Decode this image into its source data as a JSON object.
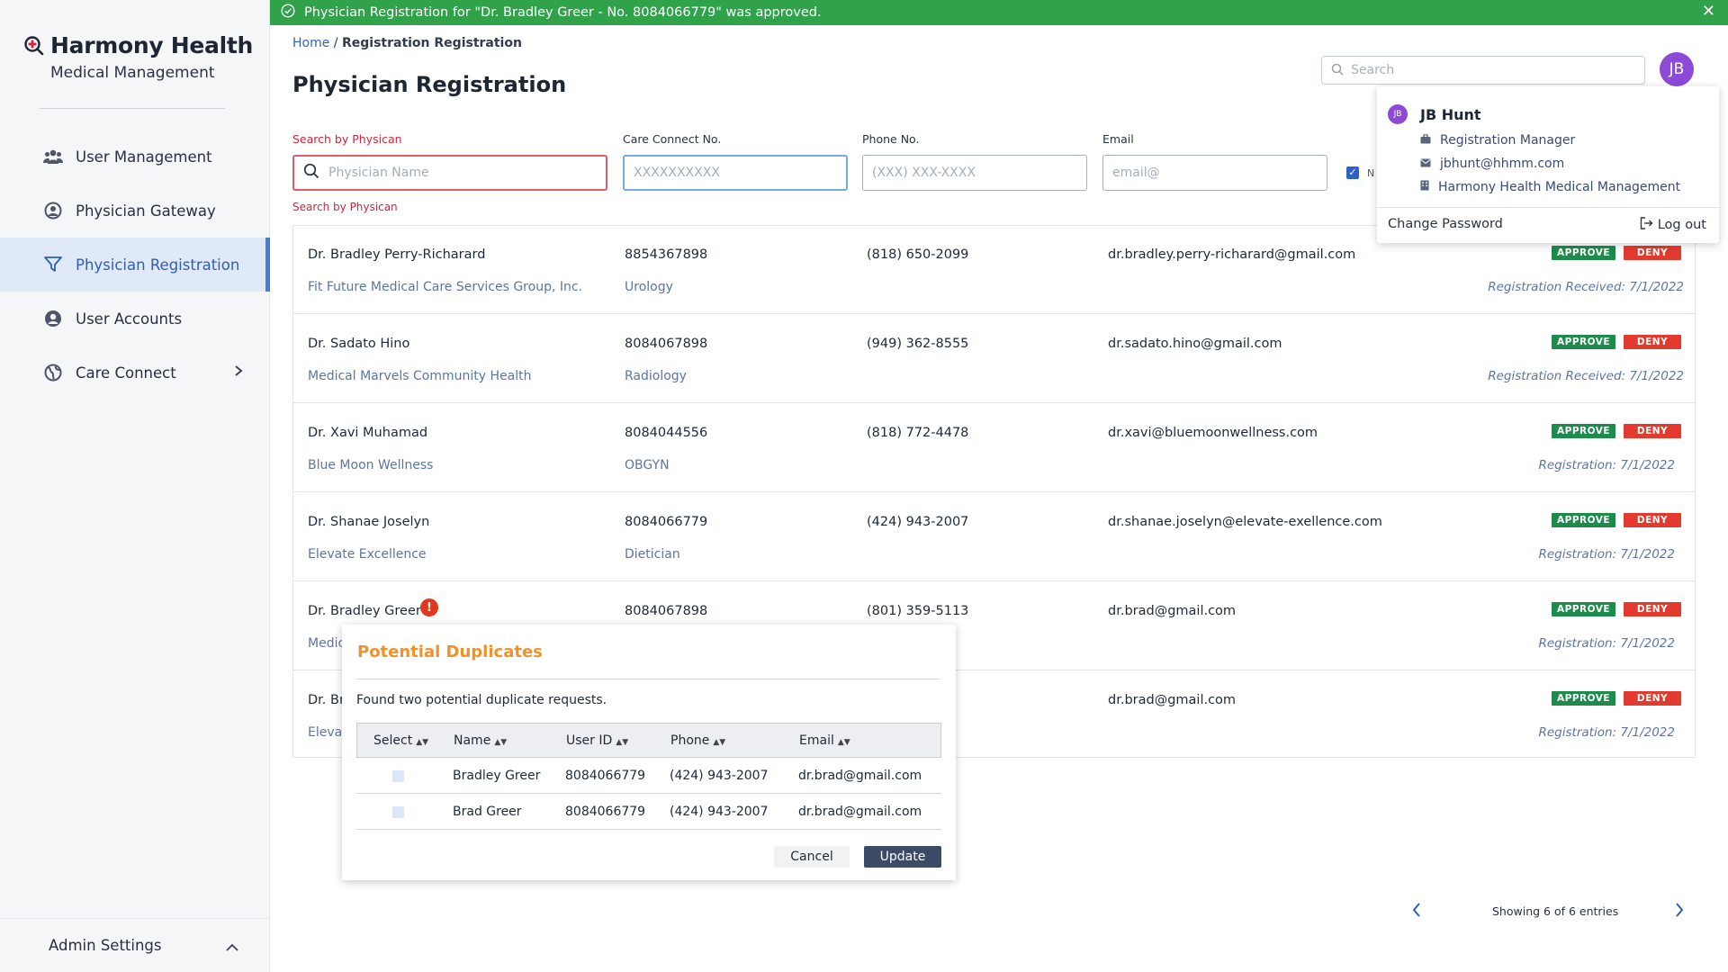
{
  "app": {
    "brand_title": "Harmony Health",
    "brand_subtitle": "Medical Management"
  },
  "banner": {
    "message": "Physician Registration for \"Dr. Bradley Greer - No. 8084066779\" was approved.",
    "color": "#2fa24a"
  },
  "sidebar": {
    "items": [
      {
        "label": "User Management",
        "icon": "users-icon"
      },
      {
        "label": "Physician Gateway",
        "icon": "user-circle-icon"
      },
      {
        "label": "Physician Registration",
        "icon": "filter-icon",
        "active": true
      },
      {
        "label": "User Accounts",
        "icon": "account-icon"
      },
      {
        "label": "Care Connect",
        "icon": "globe-icon"
      }
    ],
    "admin_label": "Admin Settings"
  },
  "breadcrumb": {
    "home": "Home",
    "separator": "/",
    "current": "Registration Registration"
  },
  "page_title": "Physician Registration",
  "top_search": {
    "placeholder": "Search"
  },
  "user": {
    "initials": "JB"
  },
  "filters": {
    "physician": {
      "label": "Search by Physican",
      "placeholder": "Physician Name",
      "hint": "Search by Physican"
    },
    "care_connect": {
      "label": "Care Connect No.",
      "placeholder": "XXXXXXXXXX"
    },
    "phone": {
      "label": "Phone No.",
      "placeholder": "(XXX) XXX-XXXX"
    },
    "email": {
      "label": "Email",
      "placeholder": "email@"
    },
    "extra_checkbox_label": "N"
  },
  "actions": {
    "approve": "APPROVE",
    "deny": "DENY"
  },
  "rows": [
    {
      "name": "Dr. Bradley Perry-Richarard",
      "org": "Fit Future Medical Care Services Group, Inc.",
      "id": "8854367898",
      "specialty": "Urology",
      "phone": "(818) 650-2099",
      "email": "dr.bradley.perry-richarard@gmail.com",
      "registration": "Registration Received: 7/1/2022"
    },
    {
      "name": "Dr. Sadato Hino",
      "org": "Medical Marvels Community Health",
      "id": "8084067898",
      "specialty": "Radiology",
      "phone": "(949) 362-8555",
      "email": "dr.sadato.hino@gmail.com",
      "registration": "Registration Received: 7/1/2022"
    },
    {
      "name": "Dr. Xavi Muhamad",
      "org": "Blue Moon Wellness",
      "id": "8084044556",
      "specialty": "OBGYN",
      "phone": "(818) 772-4478",
      "email": "dr.xavi@bluemoonwellness.com",
      "registration": "Registration: 7/1/2022"
    },
    {
      "name": "Dr. Shanae Joselyn",
      "org": "Elevate Excellence",
      "id": "8084066779",
      "specialty": "Dietician",
      "phone": "(424) 943-2007",
      "email": "dr.shanae.joselyn@elevate-exellence.com",
      "registration": "Registration: 7/1/2022"
    },
    {
      "name": "Dr. Bradley Greer",
      "org": "Medic",
      "id": "8084067898",
      "specialty": "",
      "phone": "(801) 359-5113",
      "email": "dr.brad@gmail.com",
      "registration": "Registration: 7/1/2022"
    },
    {
      "name": "Dr. Br",
      "org": "Elevat",
      "id": "",
      "specialty": "",
      "phone": "",
      "email": "dr.brad@gmail.com",
      "registration": "Registration: 7/1/2022"
    }
  ],
  "pagination": {
    "text": "Showing 6 of 6 entries"
  },
  "duplicates_modal": {
    "title": "Potential Duplicates",
    "message": "Found two potential duplicate requests.",
    "columns": [
      "Select",
      "Name",
      "User ID",
      "Phone",
      "Email"
    ],
    "rows": [
      {
        "name": "Bradley Greer",
        "user_id": "8084066779",
        "phone": "(424) 943-2007",
        "email": "dr.brad@gmail.com"
      },
      {
        "name": "Brad Greer",
        "user_id": "8084066779",
        "phone": "(424) 943-2007",
        "email": "dr.brad@gmail.com"
      }
    ],
    "cancel_label": "Cancel",
    "update_label": "Update"
  },
  "profile_menu": {
    "initials": "JB",
    "name": "JB Hunt",
    "role": "Registration Manager",
    "email": "jbhunt@hhmm.com",
    "organization": "Harmony Health Medical Management",
    "change_password": "Change Password",
    "logout": "Log out"
  }
}
